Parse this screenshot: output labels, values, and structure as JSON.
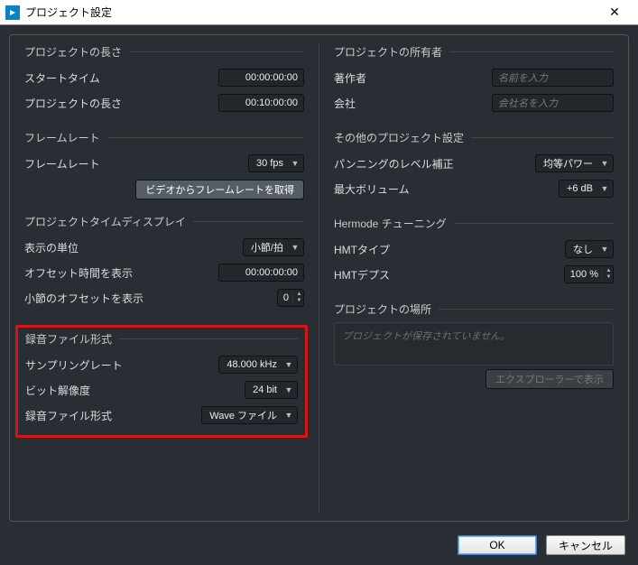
{
  "window": {
    "title": "プロジェクト設定"
  },
  "left": {
    "length": {
      "title": "プロジェクトの長さ",
      "start_label": "スタートタイム",
      "start_value": "00:00:00:00",
      "length_label": "プロジェクトの長さ",
      "length_value": "00:10:00:00"
    },
    "framerate": {
      "title": "フレームレート",
      "rate_label": "フレームレート",
      "rate_value": "30 fps",
      "from_video_btn": "ビデオからフレームレートを取得"
    },
    "timedisplay": {
      "title": "プロジェクトタイムディスプレイ",
      "format_label": "表示の単位",
      "format_value": "小節/拍",
      "offset_time_label": "オフセット時間を表示",
      "offset_time_value": "00:00:00:00",
      "bar_offset_label": "小節のオフセットを表示",
      "bar_offset_value": "0"
    },
    "record": {
      "title": "録音ファイル形式",
      "samplerate_label": "サンプリングレート",
      "samplerate_value": "48.000 kHz",
      "bitdepth_label": "ビット解像度",
      "bitdepth_value": "24 bit",
      "filetype_label": "録音ファイル形式",
      "filetype_value": "Wave ファイル"
    }
  },
  "right": {
    "owner": {
      "title": "プロジェクトの所有者",
      "author_label": "著作者",
      "author_placeholder": "名前を入力",
      "company_label": "会社",
      "company_placeholder": "会社名を入力"
    },
    "other": {
      "title": "その他のプロジェクト設定",
      "panlaw_label": "パンニングのレベル補正",
      "panlaw_value": "均等パワー",
      "maxvol_label": "最大ボリューム",
      "maxvol_value": "+6 dB"
    },
    "hermode": {
      "title": "Hermode チューニング",
      "type_label": "HMTタイプ",
      "type_value": "なし",
      "depth_label": "HMTデプス",
      "depth_value": "100 %"
    },
    "location": {
      "title": "プロジェクトの場所",
      "message": "プロジェクトが保存されていません。",
      "explorer_btn": "エクスプローラーで表示"
    }
  },
  "footer": {
    "ok": "OK",
    "cancel": "キャンセル"
  }
}
